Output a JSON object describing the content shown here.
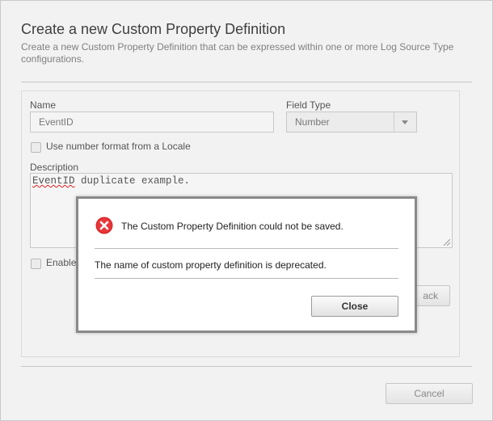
{
  "dialog": {
    "title": "Create a new Custom Property Definition",
    "subtitle": "Create a new Custom Property Definition that can be expressed within one or more Log Source Type configurations."
  },
  "form": {
    "name_label": "Name",
    "name_value": "EventID",
    "field_type_label": "Field Type",
    "field_type_value": "Number",
    "locale_checkbox_label": "Use number format from a Locale",
    "description_label": "Description",
    "description_misspelled": "EventID",
    "description_rest": " duplicate example.",
    "enable_checkbox_label_partial": "Enable",
    "back_button_partial": "ack",
    "cancel_label": "Cancel"
  },
  "error_modal": {
    "message": "The Custom Property Definition could not be saved.",
    "detail": "The name of custom property definition is deprecated.",
    "close_label": "Close",
    "icon": "error-x-icon",
    "icon_color": "#d9262a"
  }
}
